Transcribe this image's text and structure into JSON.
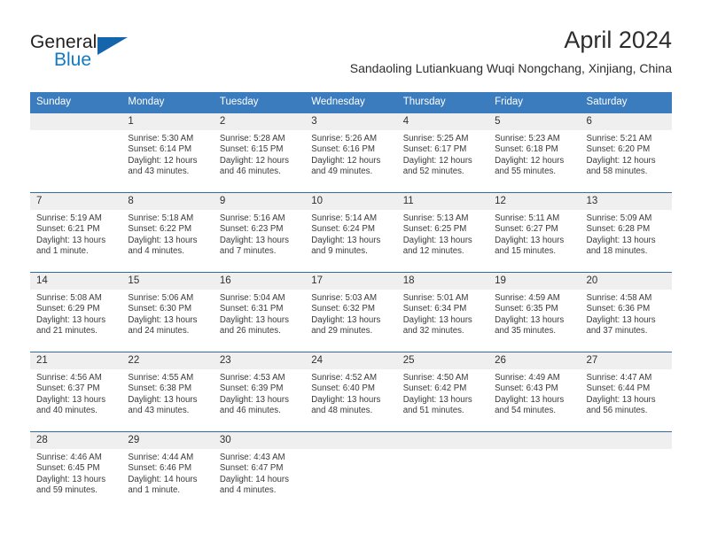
{
  "brand": {
    "word_one": "General",
    "word_two": "Blue",
    "triangle_icon": "brand-triangle-icon"
  },
  "header": {
    "month_title": "April 2024",
    "location": "Sandaoling Lutiankuang Wuqi Nongchang, Xinjiang, China"
  },
  "colors": {
    "header_blue": "#3a7cbe",
    "row_divider_blue": "#2f6ca8",
    "day_band_gray": "#efefef",
    "brand_blue": "#1279c4",
    "text": "#2f2f2f"
  },
  "weekdays": [
    "Sunday",
    "Monday",
    "Tuesday",
    "Wednesday",
    "Thursday",
    "Friday",
    "Saturday"
  ],
  "weeks": [
    [
      {
        "day": "",
        "sunrise": "",
        "sunset": "",
        "daylight_line1": "",
        "daylight_line2": "",
        "empty": true
      },
      {
        "day": "1",
        "sunrise": "Sunrise: 5:30 AM",
        "sunset": "Sunset: 6:14 PM",
        "daylight_line1": "Daylight: 12 hours",
        "daylight_line2": "and 43 minutes."
      },
      {
        "day": "2",
        "sunrise": "Sunrise: 5:28 AM",
        "sunset": "Sunset: 6:15 PM",
        "daylight_line1": "Daylight: 12 hours",
        "daylight_line2": "and 46 minutes."
      },
      {
        "day": "3",
        "sunrise": "Sunrise: 5:26 AM",
        "sunset": "Sunset: 6:16 PM",
        "daylight_line1": "Daylight: 12 hours",
        "daylight_line2": "and 49 minutes."
      },
      {
        "day": "4",
        "sunrise": "Sunrise: 5:25 AM",
        "sunset": "Sunset: 6:17 PM",
        "daylight_line1": "Daylight: 12 hours",
        "daylight_line2": "and 52 minutes."
      },
      {
        "day": "5",
        "sunrise": "Sunrise: 5:23 AM",
        "sunset": "Sunset: 6:18 PM",
        "daylight_line1": "Daylight: 12 hours",
        "daylight_line2": "and 55 minutes."
      },
      {
        "day": "6",
        "sunrise": "Sunrise: 5:21 AM",
        "sunset": "Sunset: 6:20 PM",
        "daylight_line1": "Daylight: 12 hours",
        "daylight_line2": "and 58 minutes."
      }
    ],
    [
      {
        "day": "7",
        "sunrise": "Sunrise: 5:19 AM",
        "sunset": "Sunset: 6:21 PM",
        "daylight_line1": "Daylight: 13 hours",
        "daylight_line2": "and 1 minute."
      },
      {
        "day": "8",
        "sunrise": "Sunrise: 5:18 AM",
        "sunset": "Sunset: 6:22 PM",
        "daylight_line1": "Daylight: 13 hours",
        "daylight_line2": "and 4 minutes."
      },
      {
        "day": "9",
        "sunrise": "Sunrise: 5:16 AM",
        "sunset": "Sunset: 6:23 PM",
        "daylight_line1": "Daylight: 13 hours",
        "daylight_line2": "and 7 minutes."
      },
      {
        "day": "10",
        "sunrise": "Sunrise: 5:14 AM",
        "sunset": "Sunset: 6:24 PM",
        "daylight_line1": "Daylight: 13 hours",
        "daylight_line2": "and 9 minutes."
      },
      {
        "day": "11",
        "sunrise": "Sunrise: 5:13 AM",
        "sunset": "Sunset: 6:25 PM",
        "daylight_line1": "Daylight: 13 hours",
        "daylight_line2": "and 12 minutes."
      },
      {
        "day": "12",
        "sunrise": "Sunrise: 5:11 AM",
        "sunset": "Sunset: 6:27 PM",
        "daylight_line1": "Daylight: 13 hours",
        "daylight_line2": "and 15 minutes."
      },
      {
        "day": "13",
        "sunrise": "Sunrise: 5:09 AM",
        "sunset": "Sunset: 6:28 PM",
        "daylight_line1": "Daylight: 13 hours",
        "daylight_line2": "and 18 minutes."
      }
    ],
    [
      {
        "day": "14",
        "sunrise": "Sunrise: 5:08 AM",
        "sunset": "Sunset: 6:29 PM",
        "daylight_line1": "Daylight: 13 hours",
        "daylight_line2": "and 21 minutes."
      },
      {
        "day": "15",
        "sunrise": "Sunrise: 5:06 AM",
        "sunset": "Sunset: 6:30 PM",
        "daylight_line1": "Daylight: 13 hours",
        "daylight_line2": "and 24 minutes."
      },
      {
        "day": "16",
        "sunrise": "Sunrise: 5:04 AM",
        "sunset": "Sunset: 6:31 PM",
        "daylight_line1": "Daylight: 13 hours",
        "daylight_line2": "and 26 minutes."
      },
      {
        "day": "17",
        "sunrise": "Sunrise: 5:03 AM",
        "sunset": "Sunset: 6:32 PM",
        "daylight_line1": "Daylight: 13 hours",
        "daylight_line2": "and 29 minutes."
      },
      {
        "day": "18",
        "sunrise": "Sunrise: 5:01 AM",
        "sunset": "Sunset: 6:34 PM",
        "daylight_line1": "Daylight: 13 hours",
        "daylight_line2": "and 32 minutes."
      },
      {
        "day": "19",
        "sunrise": "Sunrise: 4:59 AM",
        "sunset": "Sunset: 6:35 PM",
        "daylight_line1": "Daylight: 13 hours",
        "daylight_line2": "and 35 minutes."
      },
      {
        "day": "20",
        "sunrise": "Sunrise: 4:58 AM",
        "sunset": "Sunset: 6:36 PM",
        "daylight_line1": "Daylight: 13 hours",
        "daylight_line2": "and 37 minutes."
      }
    ],
    [
      {
        "day": "21",
        "sunrise": "Sunrise: 4:56 AM",
        "sunset": "Sunset: 6:37 PM",
        "daylight_line1": "Daylight: 13 hours",
        "daylight_line2": "and 40 minutes."
      },
      {
        "day": "22",
        "sunrise": "Sunrise: 4:55 AM",
        "sunset": "Sunset: 6:38 PM",
        "daylight_line1": "Daylight: 13 hours",
        "daylight_line2": "and 43 minutes."
      },
      {
        "day": "23",
        "sunrise": "Sunrise: 4:53 AM",
        "sunset": "Sunset: 6:39 PM",
        "daylight_line1": "Daylight: 13 hours",
        "daylight_line2": "and 46 minutes."
      },
      {
        "day": "24",
        "sunrise": "Sunrise: 4:52 AM",
        "sunset": "Sunset: 6:40 PM",
        "daylight_line1": "Daylight: 13 hours",
        "daylight_line2": "and 48 minutes."
      },
      {
        "day": "25",
        "sunrise": "Sunrise: 4:50 AM",
        "sunset": "Sunset: 6:42 PM",
        "daylight_line1": "Daylight: 13 hours",
        "daylight_line2": "and 51 minutes."
      },
      {
        "day": "26",
        "sunrise": "Sunrise: 4:49 AM",
        "sunset": "Sunset: 6:43 PM",
        "daylight_line1": "Daylight: 13 hours",
        "daylight_line2": "and 54 minutes."
      },
      {
        "day": "27",
        "sunrise": "Sunrise: 4:47 AM",
        "sunset": "Sunset: 6:44 PM",
        "daylight_line1": "Daylight: 13 hours",
        "daylight_line2": "and 56 minutes."
      }
    ],
    [
      {
        "day": "28",
        "sunrise": "Sunrise: 4:46 AM",
        "sunset": "Sunset: 6:45 PM",
        "daylight_line1": "Daylight: 13 hours",
        "daylight_line2": "and 59 minutes."
      },
      {
        "day": "29",
        "sunrise": "Sunrise: 4:44 AM",
        "sunset": "Sunset: 6:46 PM",
        "daylight_line1": "Daylight: 14 hours",
        "daylight_line2": "and 1 minute."
      },
      {
        "day": "30",
        "sunrise": "Sunrise: 4:43 AM",
        "sunset": "Sunset: 6:47 PM",
        "daylight_line1": "Daylight: 14 hours",
        "daylight_line2": "and 4 minutes."
      },
      {
        "day": "",
        "sunrise": "",
        "sunset": "",
        "daylight_line1": "",
        "daylight_line2": "",
        "empty": true
      },
      {
        "day": "",
        "sunrise": "",
        "sunset": "",
        "daylight_line1": "",
        "daylight_line2": "",
        "empty": true
      },
      {
        "day": "",
        "sunrise": "",
        "sunset": "",
        "daylight_line1": "",
        "daylight_line2": "",
        "empty": true
      },
      {
        "day": "",
        "sunrise": "",
        "sunset": "",
        "daylight_line1": "",
        "daylight_line2": "",
        "empty": true
      }
    ]
  ]
}
